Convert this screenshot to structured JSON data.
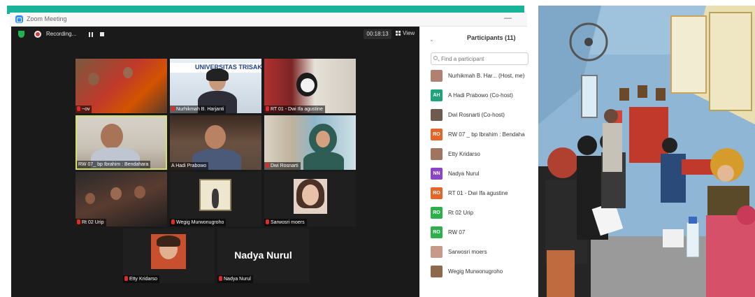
{
  "window": {
    "title": "Zoom Meeting",
    "minimize_glyph": "—"
  },
  "toolbar": {
    "recording_label": "Recording...",
    "timer": "00:18:13",
    "view_label": "View"
  },
  "tiles": [
    {
      "name": "~ov",
      "muted": true
    },
    {
      "name": "Nurhikmah B. Harjanti",
      "muted": true,
      "banner_text": "UNIVERSITAS TRISAKTI"
    },
    {
      "name": "RT 01 - Dwi Ifa agustine",
      "muted": true
    },
    {
      "name": "RW 07_ bp Ibrahim : Bendahara",
      "muted": false,
      "active": true
    },
    {
      "name": "A Hadi Prabowo",
      "muted": false
    },
    {
      "name": "Dwi Rosnarti",
      "muted": true
    },
    {
      "name": "Rt 02 Urip",
      "muted": true
    },
    {
      "name": "Wegig Murwonugroho",
      "muted": true
    },
    {
      "name": "Sarwosri moers",
      "muted": true
    },
    {
      "name": "Etty Kridarso",
      "muted": true
    },
    {
      "name": "Nadya Nurul",
      "muted": true,
      "display": "Nadya Nurul"
    }
  ],
  "participants_panel": {
    "title": "Participants (11)",
    "search_placeholder": "Find a participant",
    "items": [
      {
        "name": "Nurhikmah B. Har... (Host, me)",
        "avatar": "photo",
        "color": "#b08070"
      },
      {
        "name": "A Hadi Prabowo (Co-host)",
        "avatar": "AH",
        "color": "#1fa37d"
      },
      {
        "name": "Dwi Rosnarti (Co-host)",
        "avatar": "photo",
        "color": "#6e5a4e"
      },
      {
        "name": "RW 07 _ bp Ibrahim : Bendaha",
        "avatar": "RO",
        "color": "#e4652a"
      },
      {
        "name": "Etty Kridarso",
        "avatar": "photo",
        "color": "#a07560"
      },
      {
        "name": "Nadya Nurul",
        "avatar": "NN",
        "color": "#8a44c9"
      },
      {
        "name": "RT 01 - Dwi Ifa agustine",
        "avatar": "RO",
        "color": "#e4652a"
      },
      {
        "name": "Rt 02 Urip",
        "avatar": "RO",
        "color": "#2db04b"
      },
      {
        "name": "RW 07",
        "avatar": "RO",
        "color": "#2db04b"
      },
      {
        "name": "Sarwosri moers",
        "avatar": "photo",
        "color": "#c8988a"
      },
      {
        "name": "Wegig Murwonugroho",
        "avatar": "photo",
        "color": "#8a6a4a"
      }
    ]
  }
}
